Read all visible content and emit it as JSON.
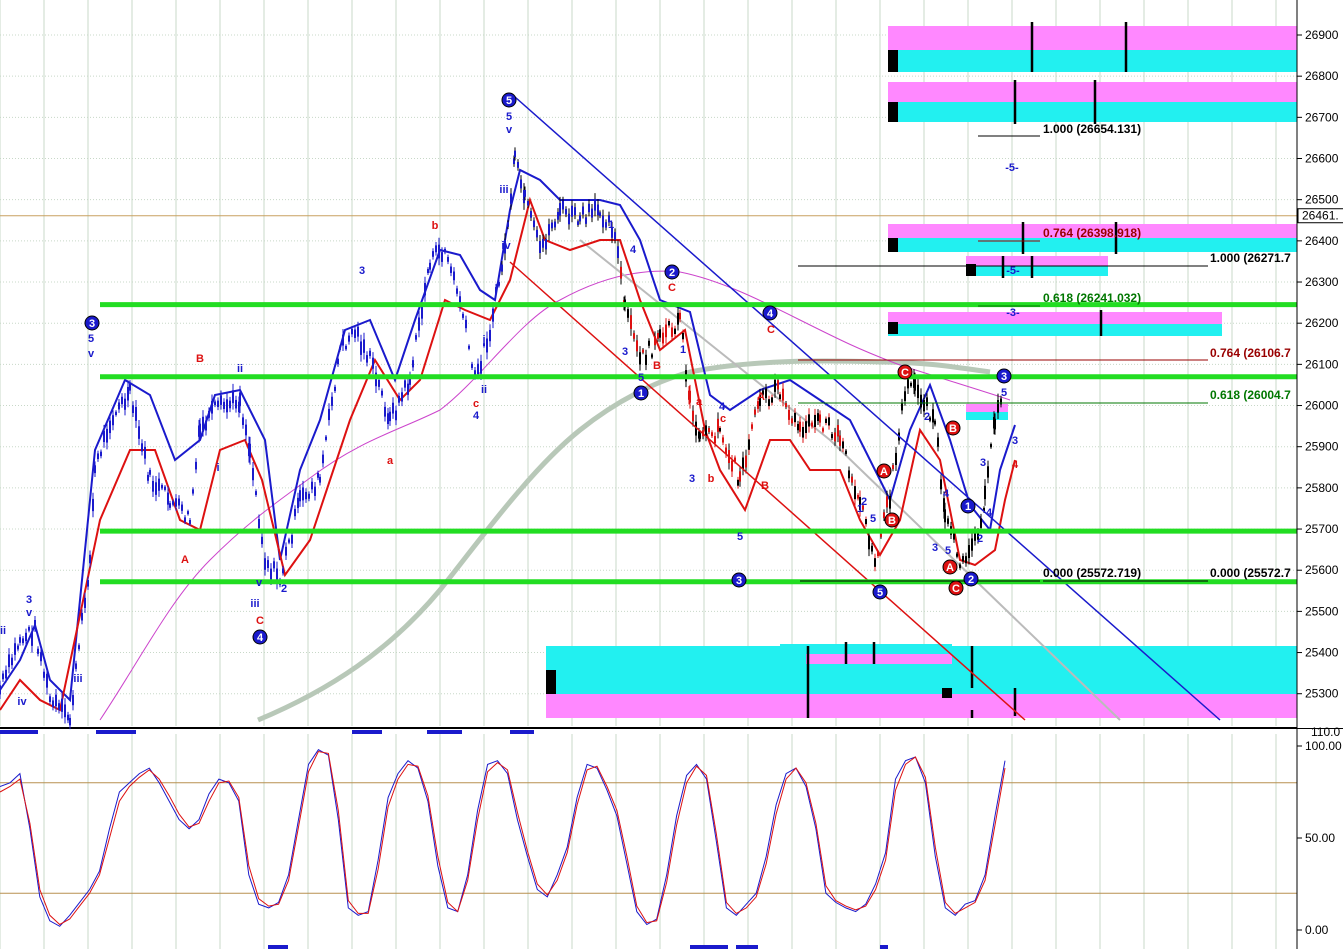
{
  "colors": {
    "green_level": "#22dd22",
    "blue": "#1a1acc",
    "red": "#dd1111",
    "magenta": "#ff88ff",
    "cyan": "#22f0f0",
    "gray": "#b8c8b8",
    "grid": "#c8d8c8",
    "price_line": "#c8a060",
    "fib_red": "#990000",
    "fib_green": "#007700"
  },
  "chart_data": [
    {
      "type": "line",
      "title": "",
      "price_axis": {
        "ticks": [
          "26900",
          "26800",
          "26700",
          "26600",
          "26500",
          "26400",
          "26300",
          "26200",
          "26100",
          "26000",
          "25900",
          "25800",
          "25700",
          "25600",
          "25500",
          "25400",
          "25300"
        ],
        "current_price_label": "26461."
      },
      "horizontal_levels": [
        26245,
        26070,
        25695,
        25572
      ],
      "current_price": 26461,
      "fib_labels": [
        {
          "text": "1.000 (26654.131)",
          "color": "black"
        },
        {
          "text": "0.764 (26398.918)",
          "color": "darkred"
        },
        {
          "text": "0.618 (26241.032)",
          "color": "green"
        },
        {
          "text": "1.000 (26271.7",
          "color": "black"
        },
        {
          "text": "0.764 (26106.7",
          "color": "darkred"
        },
        {
          "text": "0.618 (26004.7",
          "color": "green"
        },
        {
          "text": "0.000 (25572.719)",
          "color": "black"
        },
        {
          "text": "0.000 (25572.7",
          "color": "black"
        }
      ],
      "wave_circles": [
        {
          "text": "3",
          "color": "blue"
        },
        {
          "text": "4",
          "color": "blue"
        },
        {
          "text": "5",
          "color": "blue"
        },
        {
          "text": "1",
          "color": "blue"
        },
        {
          "text": "2",
          "color": "blue"
        },
        {
          "text": "3",
          "color": "blue"
        },
        {
          "text": "4",
          "color": "blue"
        },
        {
          "text": "5",
          "color": "blue"
        },
        {
          "text": "C",
          "color": "red"
        },
        {
          "text": "B",
          "color": "red"
        },
        {
          "text": "A",
          "color": "red"
        },
        {
          "text": "B",
          "color": "red"
        },
        {
          "text": "1",
          "color": "blue"
        },
        {
          "text": "A",
          "color": "red"
        },
        {
          "text": "2",
          "color": "blue"
        },
        {
          "text": "C",
          "color": "red"
        },
        {
          "text": "3",
          "color": "blue"
        }
      ],
      "wave_labels": [
        "ii",
        "3",
        "v",
        "iv",
        "iii",
        "5",
        "v",
        "B",
        "A",
        "ii",
        "i",
        "iii",
        "v",
        "C",
        "2",
        "3",
        "a",
        "b",
        "c",
        "4",
        "ii",
        "i",
        "5",
        "v",
        "iii",
        "iv",
        "1",
        "4",
        "5",
        "3",
        "B",
        "C",
        "1",
        "4",
        "a",
        "c",
        "3",
        "b",
        "5",
        "A",
        "C",
        "B",
        "-5-",
        "-5-",
        "-3-",
        "2",
        "3",
        "4",
        "5",
        "3",
        "5",
        "4",
        "2",
        "3",
        "4",
        "5",
        "1",
        "2"
      ]
    },
    {
      "type": "line",
      "title": "",
      "oscillator_axis": {
        "ticks": [
          "100.00",
          "50.00",
          "0.00"
        ],
        "top_label": "110.0"
      },
      "range": [
        0,
        100
      ],
      "series": [
        {
          "values": [
            78,
            80,
            85,
            55,
            18,
            5,
            2,
            8,
            15,
            22,
            32,
            55,
            75,
            80,
            85,
            88,
            80,
            70,
            60,
            55,
            60,
            74,
            82,
            80,
            70,
            30,
            14,
            12,
            15,
            30,
            60,
            90,
            98,
            95,
            60,
            12,
            8,
            10,
            38,
            72,
            85,
            92,
            88,
            70,
            35,
            12,
            10,
            30,
            65,
            90,
            92,
            85,
            60,
            40,
            22,
            18,
            30,
            45,
            72,
            90,
            88,
            76,
            62,
            36,
            10,
            3,
            6,
            30,
            62,
            84,
            90,
            82,
            48,
            12,
            8,
            14,
            20,
            40,
            68,
            85,
            88,
            78,
            55,
            20,
            15,
            12,
            10,
            14,
            25,
            42,
            82,
            92,
            94,
            80,
            40,
            12,
            8,
            14,
            16,
            30,
            62,
            92
          ]
        },
        {
          "values": [
            75,
            78,
            82,
            58,
            22,
            8,
            3,
            6,
            13,
            20,
            30,
            50,
            70,
            78,
            83,
            87,
            82,
            73,
            63,
            56,
            58,
            70,
            80,
            81,
            72,
            35,
            17,
            13,
            14,
            27,
            56,
            86,
            97,
            96,
            65,
            16,
            9,
            9,
            33,
            67,
            82,
            90,
            89,
            73,
            40,
            15,
            10,
            27,
            60,
            86,
            91,
            87,
            64,
            43,
            25,
            19,
            27,
            42,
            68,
            87,
            89,
            78,
            65,
            40,
            13,
            4,
            5,
            26,
            57,
            80,
            89,
            84,
            52,
            15,
            9,
            12,
            18,
            36,
            63,
            82,
            88,
            80,
            58,
            24,
            16,
            13,
            11,
            13,
            22,
            38,
            76,
            90,
            94,
            83,
            45,
            15,
            9,
            12,
            15,
            27,
            57,
            88
          ]
        }
      ]
    }
  ]
}
